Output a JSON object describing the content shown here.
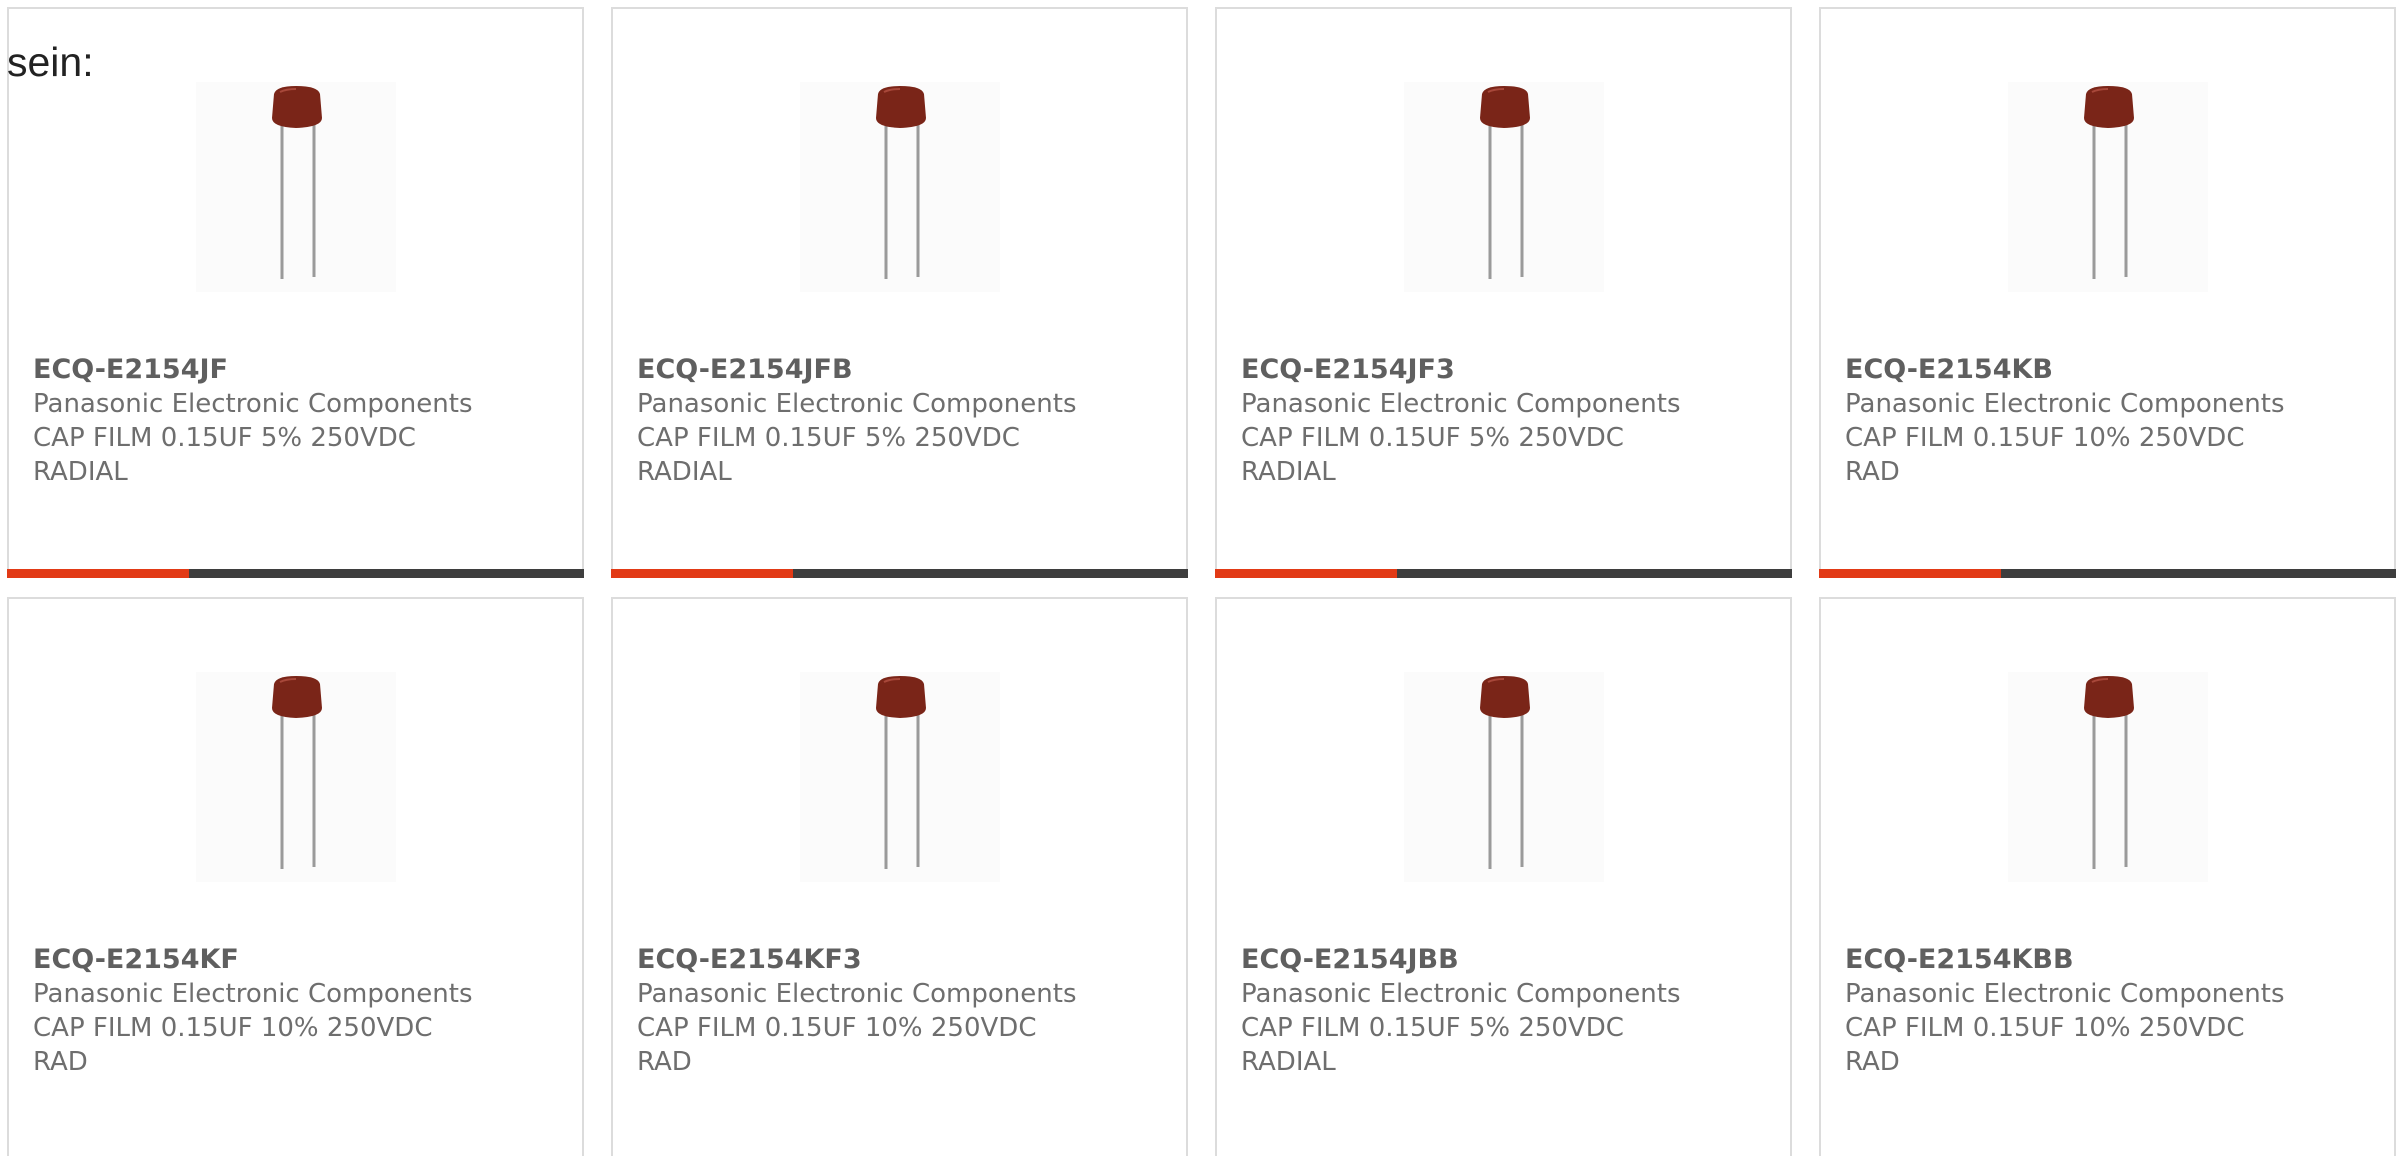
{
  "intro_text": "sein:",
  "colors": {
    "accent": "#e23a16",
    "bar_track": "#3e3e3e",
    "capacitor_body": "#7a2518",
    "text": "#6e6e6e"
  },
  "products": [
    {
      "part_number": "ECQ-E2154JF",
      "manufacturer": "Panasonic Electronic Components",
      "description_line1": "CAP FILM 0.15UF 5% 250VDC",
      "description_line2": "RADIAL",
      "image_icon": "film-capacitor-image",
      "progress_fraction": 0.315
    },
    {
      "part_number": "ECQ-E2154JFB",
      "manufacturer": "Panasonic Electronic Components",
      "description_line1": "CAP FILM 0.15UF 5% 250VDC",
      "description_line2": "RADIAL",
      "image_icon": "film-capacitor-image",
      "progress_fraction": 0.315
    },
    {
      "part_number": "ECQ-E2154JF3",
      "manufacturer": "Panasonic Electronic Components",
      "description_line1": "CAP FILM 0.15UF 5% 250VDC",
      "description_line2": "RADIAL",
      "image_icon": "film-capacitor-image",
      "progress_fraction": 0.315
    },
    {
      "part_number": "ECQ-E2154KB",
      "manufacturer": "Panasonic Electronic Components",
      "description_line1": "CAP FILM 0.15UF 10% 250VDC",
      "description_line2": "RAD",
      "image_icon": "film-capacitor-image",
      "progress_fraction": 0.315
    },
    {
      "part_number": "ECQ-E2154KF",
      "manufacturer": "Panasonic Electronic Components",
      "description_line1": "CAP FILM 0.15UF 10% 250VDC",
      "description_line2": "RAD",
      "image_icon": "film-capacitor-image"
    },
    {
      "part_number": "ECQ-E2154KF3",
      "manufacturer": "Panasonic Electronic Components",
      "description_line1": "CAP FILM 0.15UF 10% 250VDC",
      "description_line2": "RAD",
      "image_icon": "film-capacitor-image"
    },
    {
      "part_number": "ECQ-E2154JBB",
      "manufacturer": "Panasonic Electronic Components",
      "description_line1": "CAP FILM 0.15UF 5% 250VDC",
      "description_line2": "RADIAL",
      "image_icon": "film-capacitor-image"
    },
    {
      "part_number": "ECQ-E2154KBB",
      "manufacturer": "Panasonic Electronic Components",
      "description_line1": "CAP FILM 0.15UF 10% 250VDC",
      "description_line2": "RAD",
      "image_icon": "film-capacitor-image"
    }
  ]
}
